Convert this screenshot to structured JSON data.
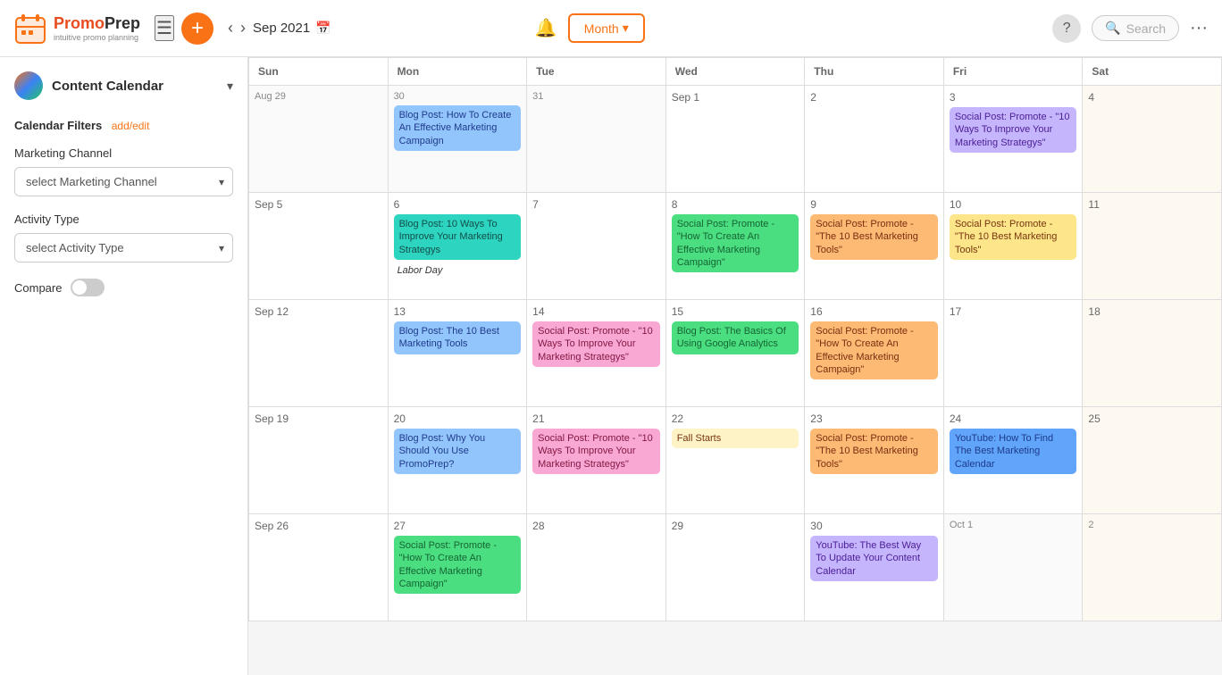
{
  "header": {
    "logo_name": "PromoPrep",
    "logo_sub": "intuitive promo planning",
    "menu_label": "☰",
    "add_label": "+",
    "current_date": "Sep 2021",
    "bell_label": "🔔",
    "month_label": "Month",
    "help_label": "?",
    "search_placeholder": "Search",
    "more_label": "···"
  },
  "sidebar": {
    "title": "Content Calendar",
    "filters_label": "Calendar Filters",
    "filters_link": "add/edit",
    "marketing_channel_label": "Marketing Channel",
    "marketing_channel_placeholder": "select Marketing Channel",
    "activity_type_label": "Activity Type",
    "activity_type_placeholder": "select Activity Type",
    "compare_label": "Compare"
  },
  "calendar": {
    "day_headers": [
      {
        "label": "Sun"
      },
      {
        "label": "Mon"
      },
      {
        "label": "Tue"
      },
      {
        "label": "Wed"
      },
      {
        "label": "Thu"
      },
      {
        "label": "Fri"
      },
      {
        "label": "Sat"
      }
    ],
    "weeks": [
      {
        "days": [
          {
            "date": "Aug 29",
            "type": "other",
            "events": []
          },
          {
            "date": "30",
            "type": "other",
            "events": [
              {
                "text": "Blog Post: How To Create An Effective Marketing Campaign",
                "color": "blue"
              }
            ]
          },
          {
            "date": "31",
            "type": "other",
            "events": []
          },
          {
            "date": "Sep 1",
            "type": "normal",
            "events": []
          },
          {
            "date": "2",
            "type": "normal",
            "events": []
          },
          {
            "date": "3",
            "type": "normal",
            "events": [
              {
                "text": "Social Post: Promote - \"10 Ways To Improve Your Marketing Strategys\"",
                "color": "purple"
              }
            ]
          },
          {
            "date": "4",
            "type": "weekend",
            "events": []
          }
        ]
      },
      {
        "days": [
          {
            "date": "Sep 5",
            "type": "normal",
            "events": []
          },
          {
            "date": "6",
            "type": "normal",
            "events": [
              {
                "text": "Blog Post: 10 Ways To Improve Your Marketing Strategys",
                "color": "teal"
              },
              {
                "text": "Labor Day",
                "color": "holiday"
              }
            ]
          },
          {
            "date": "7",
            "type": "normal",
            "events": []
          },
          {
            "date": "8",
            "type": "normal",
            "events": [
              {
                "text": "Social Post: Promote - \"How To Create An Effective Marketing Campaign\"",
                "color": "green"
              }
            ]
          },
          {
            "date": "9",
            "type": "normal",
            "events": [
              {
                "text": "Social Post: Promote - \"The 10 Best Marketing Tools\"",
                "color": "orange"
              }
            ]
          },
          {
            "date": "10",
            "type": "normal",
            "events": [
              {
                "text": "Social Post: Promote - \"The 10 Best Marketing Tools\"",
                "color": "yellow"
              }
            ]
          },
          {
            "date": "11",
            "type": "weekend",
            "events": []
          }
        ]
      },
      {
        "days": [
          {
            "date": "Sep 12",
            "type": "normal",
            "events": []
          },
          {
            "date": "13",
            "type": "normal",
            "events": [
              {
                "text": "Blog Post: The 10 Best Marketing Tools",
                "color": "blue"
              }
            ]
          },
          {
            "date": "14",
            "type": "normal",
            "events": [
              {
                "text": "Social Post: Promote - \"10 Ways To Improve Your Marketing Strategys\"",
                "color": "pink"
              }
            ]
          },
          {
            "date": "15",
            "type": "normal",
            "events": [
              {
                "text": "Blog Post: The Basics Of Using Google Analytics",
                "color": "green"
              }
            ]
          },
          {
            "date": "16",
            "type": "normal",
            "events": [
              {
                "text": "Social Post: Promote - \"How To Create An Effective Marketing Campaign\"",
                "color": "orange"
              }
            ]
          },
          {
            "date": "17",
            "type": "normal",
            "events": []
          },
          {
            "date": "18",
            "type": "weekend",
            "events": []
          }
        ]
      },
      {
        "days": [
          {
            "date": "Sep 19",
            "type": "normal",
            "events": []
          },
          {
            "date": "20",
            "type": "normal",
            "events": [
              {
                "text": "Blog Post: Why You Should You Use PromoPrep?",
                "color": "blue"
              }
            ]
          },
          {
            "date": "21",
            "type": "normal",
            "events": [
              {
                "text": "Social Post: Promote - \"10 Ways To Improve Your Marketing Strategys\"",
                "color": "pink"
              }
            ]
          },
          {
            "date": "22",
            "type": "normal",
            "events": [
              {
                "text": "Fall Starts",
                "color": "fall"
              }
            ]
          },
          {
            "date": "23",
            "type": "normal",
            "events": [
              {
                "text": "Social Post: Promote - \"The 10 Best Marketing Tools\"",
                "color": "orange"
              }
            ]
          },
          {
            "date": "24",
            "type": "normal",
            "events": [
              {
                "text": "YouTube: How To Find The Best Marketing Calendar",
                "color": "blue-dark"
              }
            ]
          },
          {
            "date": "25",
            "type": "weekend",
            "events": []
          }
        ]
      },
      {
        "days": [
          {
            "date": "Sep 26",
            "type": "normal",
            "events": []
          },
          {
            "date": "27",
            "type": "normal",
            "events": [
              {
                "text": "Social Post: Promote - \"How To Create An Effective Marketing Campaign\"",
                "color": "green"
              }
            ]
          },
          {
            "date": "28",
            "type": "normal",
            "events": []
          },
          {
            "date": "29",
            "type": "normal",
            "events": []
          },
          {
            "date": "30",
            "type": "normal",
            "events": [
              {
                "text": "YouTube: The Best Way To Update Your Content Calendar",
                "color": "purple"
              }
            ]
          },
          {
            "date": "Oct 1",
            "type": "other",
            "events": []
          },
          {
            "date": "2",
            "type": "other-weekend",
            "events": []
          }
        ]
      }
    ]
  }
}
